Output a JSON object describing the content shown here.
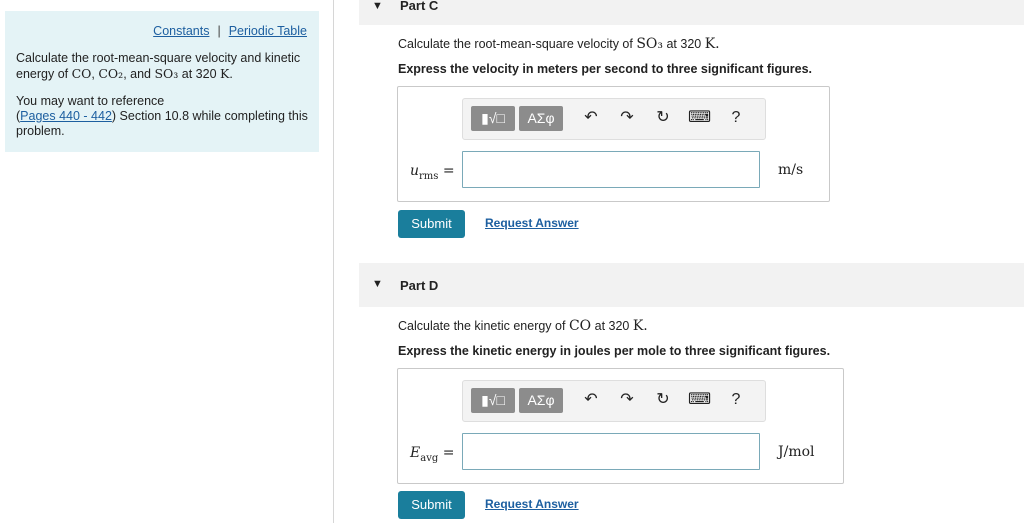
{
  "sidebar": {
    "constants_link": "Constants",
    "separator": "|",
    "periodic_link": "Periodic Table",
    "intro_part1": "Calculate the root-mean-square velocity and kinetic energy of ",
    "co": "CO",
    "comma1": ", ",
    "co2": "CO₂",
    "and": ", and ",
    "so3": "SO₃",
    "at": " at 320 ",
    "kelvin": "K",
    "period": ".",
    "ref_line1": "You may want to reference",
    "ref_open": "(",
    "pages_link": "Pages 440 - 442",
    "ref_rest": ") Section 10.8 while completing this problem."
  },
  "part_c": {
    "title": "Part C",
    "question_prefix": "Calculate the root-mean-square velocity of ",
    "question_formula": "SO₃",
    "question_at": " at 320 ",
    "question_unit": "K.",
    "instruction": "Express the velocity in meters per second to three significant figures.",
    "toolbar": {
      "templates": "▮√□",
      "greek": "ΑΣφ",
      "undo": "↶",
      "redo": "↷",
      "reset": "↻",
      "keyboard": "⌨",
      "help": "?"
    },
    "var_main": "u",
    "var_sub": "rms",
    "equals": " =",
    "input_value": "",
    "unit": "m/s",
    "submit": "Submit",
    "request": "Request Answer"
  },
  "part_d": {
    "title": "Part D",
    "question_prefix": "Calculate the kinetic energy of ",
    "question_formula": "CO",
    "question_at": " at 320 ",
    "question_unit": "K.",
    "instruction": "Express the kinetic energy in joules per mole to three significant figures.",
    "toolbar": {
      "templates": "▮√□",
      "greek": "ΑΣφ",
      "undo": "↶",
      "redo": "↷",
      "reset": "↻",
      "keyboard": "⌨",
      "help": "?"
    },
    "var_main": "E",
    "var_sub": "avg",
    "equals": " =",
    "input_value": "",
    "unit": "J/mol",
    "submit": "Submit",
    "request": "Request Answer"
  },
  "icons": {
    "collapse_icon": "▼"
  },
  "colors": {
    "info_bg": "#e4f3f6",
    "submit_bg": "#1a7e9c",
    "link": "#1d5fa0"
  }
}
